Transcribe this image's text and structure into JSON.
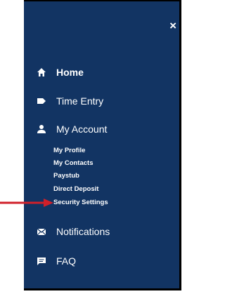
{
  "menu": {
    "close_label": "×",
    "items": [
      {
        "label": "Home",
        "icon": "home-icon"
      },
      {
        "label": "Time Entry",
        "icon": "tag-icon"
      },
      {
        "label": "My Account",
        "icon": "user-icon"
      },
      {
        "label": "Notifications",
        "icon": "envelope-icon"
      },
      {
        "label": "FAQ",
        "icon": "chat-icon"
      }
    ],
    "account_subitems": [
      {
        "label": "My Profile"
      },
      {
        "label": "My Contacts"
      },
      {
        "label": "Paystub"
      },
      {
        "label": "Direct Deposit"
      },
      {
        "label": "Security Settings"
      }
    ]
  },
  "colors": {
    "panel_bg": "#123463",
    "text": "#ffffff",
    "arrow": "#d0202a"
  }
}
